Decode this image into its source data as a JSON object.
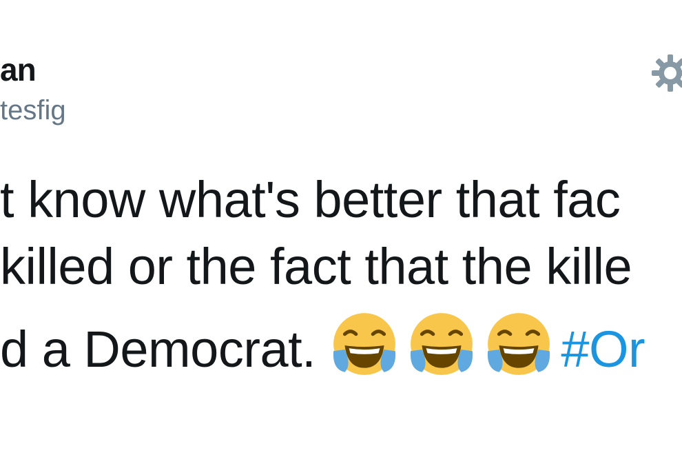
{
  "tweet": {
    "display_name": "an",
    "handle": "tesfig",
    "line_1": "t know what's better that fac",
    "line_2": "killed or the fact that the kille",
    "line_3_text": "d a Democrat. ",
    "emojis": [
      "face-with-tears-of-joy-icon",
      "face-with-tears-of-joy-icon",
      "face-with-tears-of-joy-icon"
    ],
    "hashtag": "#Or"
  },
  "icons": {
    "settings": "gear-icon"
  },
  "colors": {
    "text": "#14171a",
    "secondary_text": "#657786",
    "link": "#1b95e0",
    "gear": "#8899a6",
    "emoji_face": "#f7c64b",
    "emoji_tears": "#5fa8e0"
  }
}
